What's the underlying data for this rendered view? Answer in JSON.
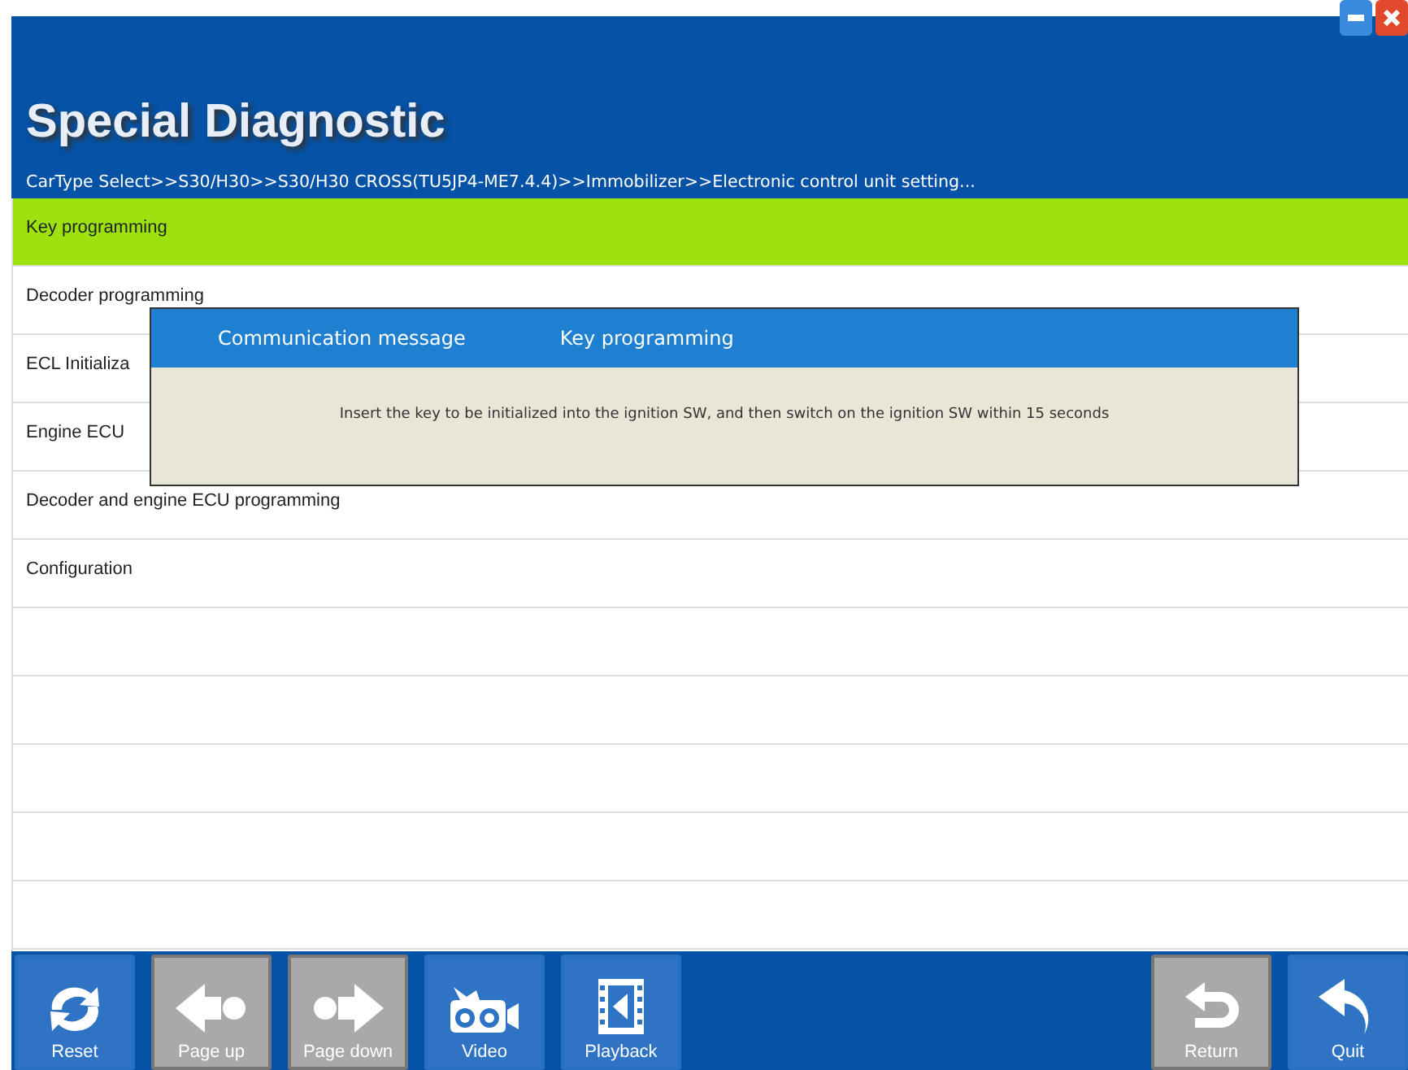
{
  "window": {
    "title": "Special Diagnostic"
  },
  "breadcrumb": "CarType Select>>S30/H30>>S30/H30 CROSS(TU5JP4-ME7.4.4)>>Immobilizer>>Electronic control unit setting...",
  "menu_items": [
    {
      "label": "Key programming",
      "selected": true
    },
    {
      "label": "Decoder programming",
      "selected": false
    },
    {
      "label": "ECL Initializa",
      "selected": false
    },
    {
      "label": "Engine ECU",
      "selected": false
    },
    {
      "label": "Decoder and engine ECU programming",
      "selected": false
    },
    {
      "label": "Configuration",
      "selected": false
    }
  ],
  "dialog": {
    "title": "Communication message",
    "subtitle": "Key programming",
    "message": "Insert the key to be initialized into the ignition SW, and then switch on the ignition SW within 15 seconds"
  },
  "toolbar": [
    {
      "kind": "reset",
      "label": "Reset",
      "disabled": false
    },
    {
      "kind": "page-up",
      "label": "Page up",
      "disabled": true
    },
    {
      "kind": "page-down",
      "label": "Page down",
      "disabled": true
    },
    {
      "kind": "video",
      "label": "Video",
      "disabled": false
    },
    {
      "kind": "playback",
      "label": "Playback",
      "disabled": false
    },
    {
      "kind": "spacer"
    },
    {
      "kind": "return",
      "label": "Return",
      "disabled": true
    },
    {
      "kind": "quit",
      "label": "Quit",
      "disabled": false
    }
  ]
}
